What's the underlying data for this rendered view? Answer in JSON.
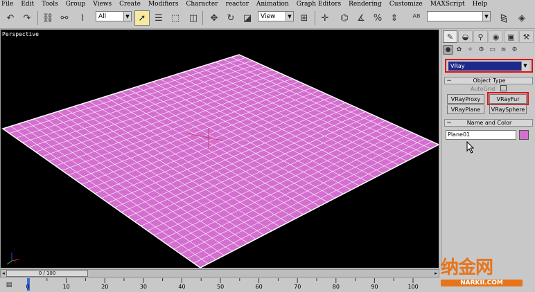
{
  "menu": [
    "File",
    "Edit",
    "Tools",
    "Group",
    "Views",
    "Create",
    "Modifiers",
    "Character",
    "reactor",
    "Animation",
    "Graph Editors",
    "Rendering",
    "Customize",
    "MAXScript",
    "Help"
  ],
  "toolbar": {
    "selection_filter": "All",
    "reference_coord": "View",
    "named_selection": ""
  },
  "viewport": {
    "label": "Perspective",
    "object_color": "#d46fd0",
    "grid_color": "#ffffff"
  },
  "command_panel": {
    "geometry_type": "VRay",
    "object_type_title": "Object Type",
    "autogrid_label": "AutoGrid",
    "buttons": [
      "VRayProxy",
      "VRayFur",
      "VRayPlane",
      "VRaySphere"
    ],
    "name_color_title": "Name and Color",
    "object_name": "Plane01",
    "object_color": "#d46fd0",
    "highlight_color": "#e01010"
  },
  "timeline": {
    "position": "0 / 100",
    "ticks": [
      "0",
      "10",
      "20",
      "30",
      "40",
      "50",
      "60",
      "70",
      "80",
      "90",
      "100"
    ]
  },
  "watermark": {
    "logo": "纳金网",
    "url": "NARKII.COM"
  }
}
